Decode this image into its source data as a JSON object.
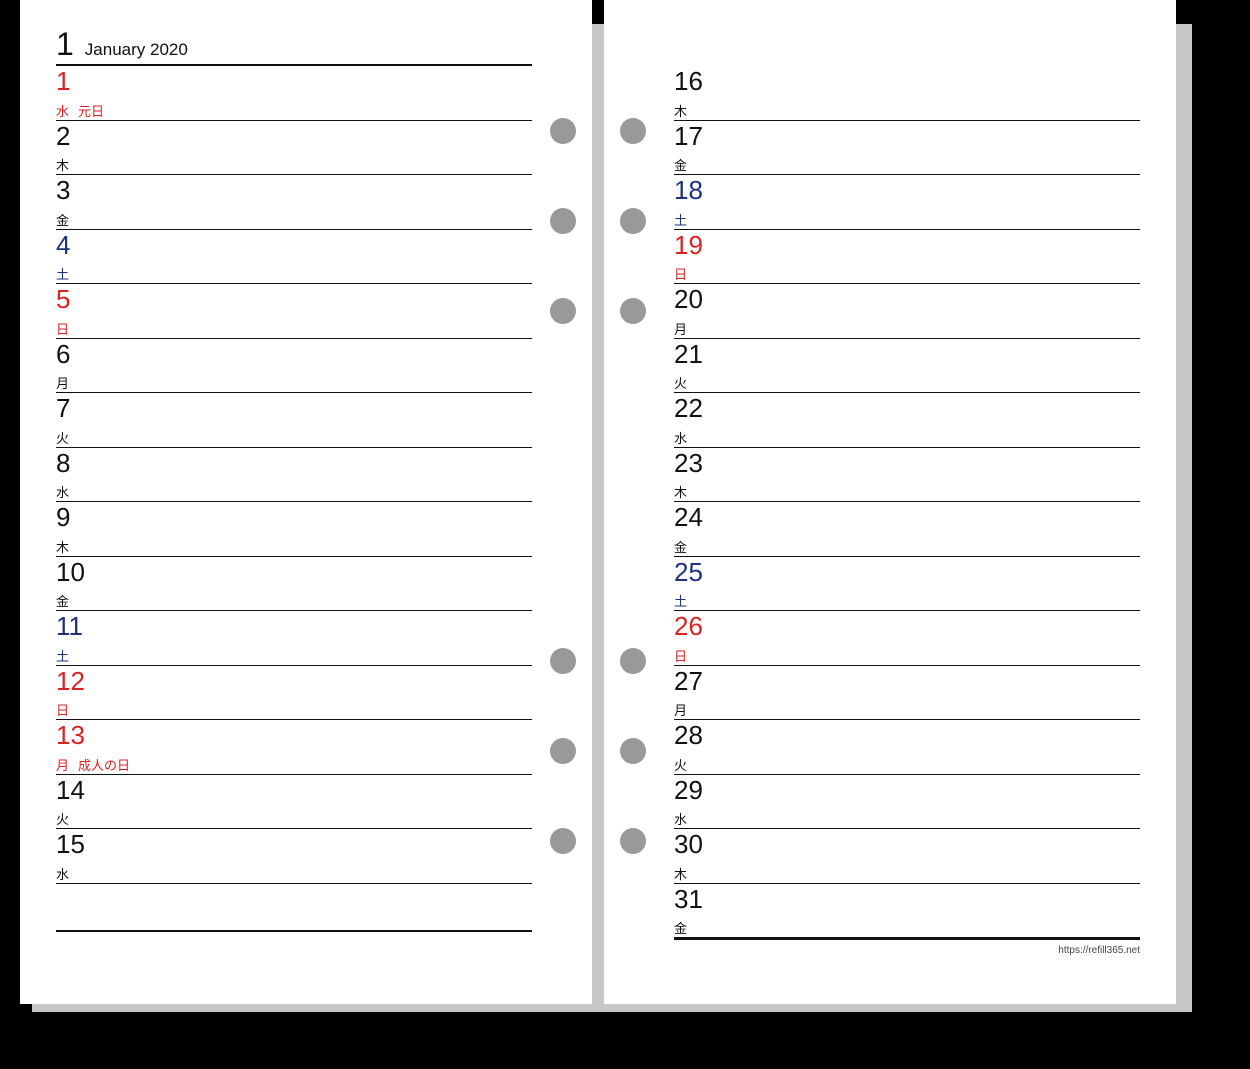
{
  "header": {
    "monthNumber": "1",
    "monthLabel": "January 2020"
  },
  "footerUrl": "https://refill365.net",
  "colors": {
    "sunday": "#d92323",
    "saturday": "#1f2f7a",
    "text": "#111",
    "hole": "#999"
  },
  "holeOffsets": [
    118,
    208,
    298,
    648,
    738,
    828
  ],
  "leftDays": [
    {
      "n": "1",
      "wd": "水",
      "holiday": "元日",
      "cls": "red"
    },
    {
      "n": "2",
      "wd": "木"
    },
    {
      "n": "3",
      "wd": "金"
    },
    {
      "n": "4",
      "wd": "土",
      "cls": "blue"
    },
    {
      "n": "5",
      "wd": "日",
      "cls": "red"
    },
    {
      "n": "6",
      "wd": "月"
    },
    {
      "n": "7",
      "wd": "火"
    },
    {
      "n": "8",
      "wd": "水"
    },
    {
      "n": "9",
      "wd": "木"
    },
    {
      "n": "10",
      "wd": "金"
    },
    {
      "n": "11",
      "wd": "土",
      "cls": "blue"
    },
    {
      "n": "12",
      "wd": "日",
      "cls": "red"
    },
    {
      "n": "13",
      "wd": "月",
      "holiday": "成人の日",
      "cls": "red"
    },
    {
      "n": "14",
      "wd": "火"
    },
    {
      "n": "15",
      "wd": "水"
    }
  ],
  "rightDays": [
    {
      "n": "16",
      "wd": "木"
    },
    {
      "n": "17",
      "wd": "金"
    },
    {
      "n": "18",
      "wd": "土",
      "cls": "blue"
    },
    {
      "n": "19",
      "wd": "日",
      "cls": "red"
    },
    {
      "n": "20",
      "wd": "月"
    },
    {
      "n": "21",
      "wd": "火"
    },
    {
      "n": "22",
      "wd": "水"
    },
    {
      "n": "23",
      "wd": "木"
    },
    {
      "n": "24",
      "wd": "金"
    },
    {
      "n": "25",
      "wd": "土",
      "cls": "blue"
    },
    {
      "n": "26",
      "wd": "日",
      "cls": "red"
    },
    {
      "n": "27",
      "wd": "月"
    },
    {
      "n": "28",
      "wd": "火"
    },
    {
      "n": "29",
      "wd": "水"
    },
    {
      "n": "30",
      "wd": "木"
    },
    {
      "n": "31",
      "wd": "金"
    }
  ]
}
